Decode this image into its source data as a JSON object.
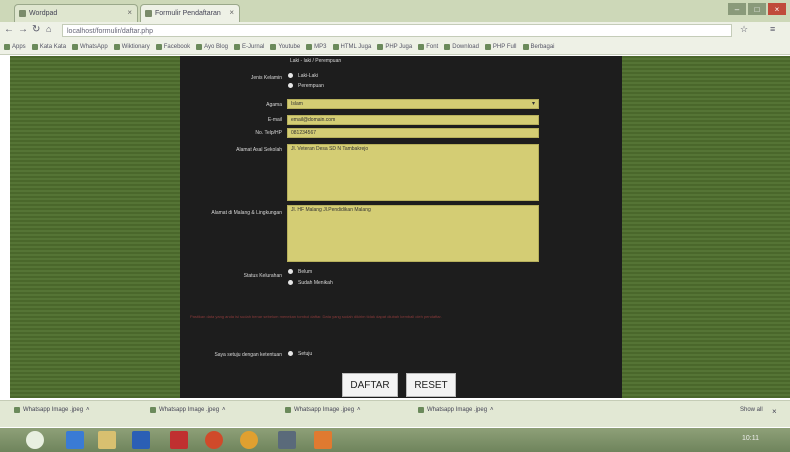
{
  "browser": {
    "tabs": [
      {
        "label": "Wordpad"
      },
      {
        "label": "Formulir Pendaftaran"
      }
    ],
    "address": "localhost/formulir/daftar.php",
    "bookmarks": [
      "Apps",
      "Kata Kata",
      "WhatsApp",
      "Wiktionary",
      "Facebook",
      "Ayo Blog",
      "E-Jurnal",
      "Youtube",
      "MP3",
      "HTML Juga",
      "PHP Juga",
      "Font",
      "Download",
      "PHP Full",
      "Berbagai"
    ]
  },
  "form": {
    "top_note": "Laki - laki / Perempuan",
    "gender_label": "Jenis Kelamin",
    "gender_options": [
      "Laki-Laki",
      "Perempuan"
    ],
    "religion_label": "Agama",
    "religion_value": "Islam",
    "email_label": "E-mail",
    "email_value": "email@domain.com",
    "phone_label": "No. Telp/HP",
    "phone_value": "081234567",
    "address_label": "Alamat Asal Sekolah",
    "address_value": "Jl. Veteran Desa SD N Tambakrejo",
    "parent_label": "Alamat di Malang & Lingkungan",
    "parent_value": "Jl. HF Malang Jl.Pendidikan Malang",
    "status_label": "Status Kelurahan",
    "status_options": [
      "Belum",
      "Sudah Menikah"
    ],
    "warning": "Pastikan data yang anda isi sudah benar sebelum menekan tombol daftar. Data yang sudah dikirim tidak dapat diubah kembali oleh pendaftar.",
    "agree_label": "Saya setuju dengan ketentuan",
    "agree_option": "Setuju",
    "submit_label": "DAFTAR",
    "reset_label": "RESET"
  },
  "downloads": {
    "items": [
      "Whatsapp Image .jpeg",
      "Whatsapp Image .jpeg",
      "Whatsapp Image .jpeg",
      "Whatsapp Image .jpeg"
    ],
    "show_all": "Show all"
  },
  "taskbar": {
    "clock": "10:11"
  }
}
